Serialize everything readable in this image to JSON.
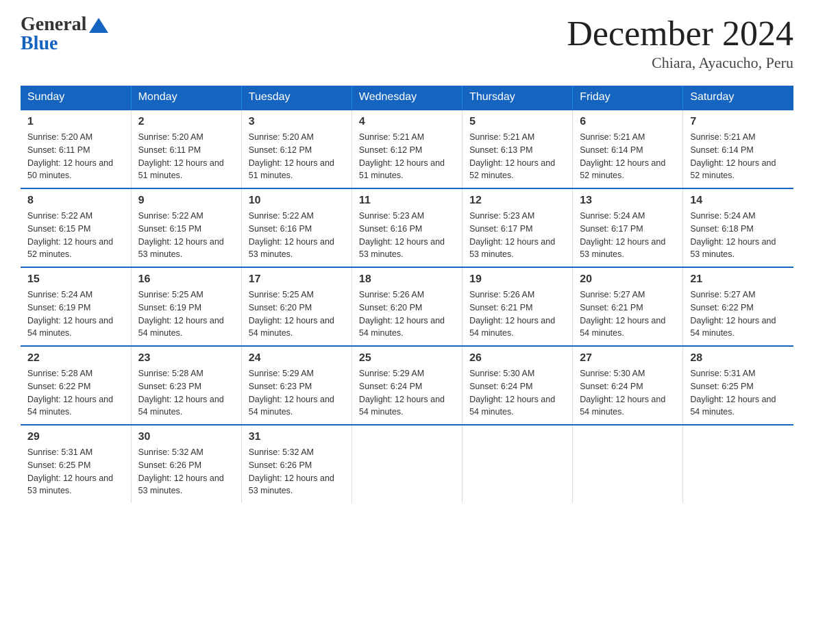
{
  "logo": {
    "general": "General",
    "triangle_color": "#1565c0",
    "blue": "Blue"
  },
  "title": {
    "month_year": "December 2024",
    "location": "Chiara, Ayacucho, Peru"
  },
  "header_days": [
    "Sunday",
    "Monday",
    "Tuesday",
    "Wednesday",
    "Thursday",
    "Friday",
    "Saturday"
  ],
  "weeks": [
    [
      {
        "day": "1",
        "sunrise": "5:20 AM",
        "sunset": "6:11 PM",
        "daylight": "12 hours and 50 minutes."
      },
      {
        "day": "2",
        "sunrise": "5:20 AM",
        "sunset": "6:11 PM",
        "daylight": "12 hours and 51 minutes."
      },
      {
        "day": "3",
        "sunrise": "5:20 AM",
        "sunset": "6:12 PM",
        "daylight": "12 hours and 51 minutes."
      },
      {
        "day": "4",
        "sunrise": "5:21 AM",
        "sunset": "6:12 PM",
        "daylight": "12 hours and 51 minutes."
      },
      {
        "day": "5",
        "sunrise": "5:21 AM",
        "sunset": "6:13 PM",
        "daylight": "12 hours and 52 minutes."
      },
      {
        "day": "6",
        "sunrise": "5:21 AM",
        "sunset": "6:14 PM",
        "daylight": "12 hours and 52 minutes."
      },
      {
        "day": "7",
        "sunrise": "5:21 AM",
        "sunset": "6:14 PM",
        "daylight": "12 hours and 52 minutes."
      }
    ],
    [
      {
        "day": "8",
        "sunrise": "5:22 AM",
        "sunset": "6:15 PM",
        "daylight": "12 hours and 52 minutes."
      },
      {
        "day": "9",
        "sunrise": "5:22 AM",
        "sunset": "6:15 PM",
        "daylight": "12 hours and 53 minutes."
      },
      {
        "day": "10",
        "sunrise": "5:22 AM",
        "sunset": "6:16 PM",
        "daylight": "12 hours and 53 minutes."
      },
      {
        "day": "11",
        "sunrise": "5:23 AM",
        "sunset": "6:16 PM",
        "daylight": "12 hours and 53 minutes."
      },
      {
        "day": "12",
        "sunrise": "5:23 AM",
        "sunset": "6:17 PM",
        "daylight": "12 hours and 53 minutes."
      },
      {
        "day": "13",
        "sunrise": "5:24 AM",
        "sunset": "6:17 PM",
        "daylight": "12 hours and 53 minutes."
      },
      {
        "day": "14",
        "sunrise": "5:24 AM",
        "sunset": "6:18 PM",
        "daylight": "12 hours and 53 minutes."
      }
    ],
    [
      {
        "day": "15",
        "sunrise": "5:24 AM",
        "sunset": "6:19 PM",
        "daylight": "12 hours and 54 minutes."
      },
      {
        "day": "16",
        "sunrise": "5:25 AM",
        "sunset": "6:19 PM",
        "daylight": "12 hours and 54 minutes."
      },
      {
        "day": "17",
        "sunrise": "5:25 AM",
        "sunset": "6:20 PM",
        "daylight": "12 hours and 54 minutes."
      },
      {
        "day": "18",
        "sunrise": "5:26 AM",
        "sunset": "6:20 PM",
        "daylight": "12 hours and 54 minutes."
      },
      {
        "day": "19",
        "sunrise": "5:26 AM",
        "sunset": "6:21 PM",
        "daylight": "12 hours and 54 minutes."
      },
      {
        "day": "20",
        "sunrise": "5:27 AM",
        "sunset": "6:21 PM",
        "daylight": "12 hours and 54 minutes."
      },
      {
        "day": "21",
        "sunrise": "5:27 AM",
        "sunset": "6:22 PM",
        "daylight": "12 hours and 54 minutes."
      }
    ],
    [
      {
        "day": "22",
        "sunrise": "5:28 AM",
        "sunset": "6:22 PM",
        "daylight": "12 hours and 54 minutes."
      },
      {
        "day": "23",
        "sunrise": "5:28 AM",
        "sunset": "6:23 PM",
        "daylight": "12 hours and 54 minutes."
      },
      {
        "day": "24",
        "sunrise": "5:29 AM",
        "sunset": "6:23 PM",
        "daylight": "12 hours and 54 minutes."
      },
      {
        "day": "25",
        "sunrise": "5:29 AM",
        "sunset": "6:24 PM",
        "daylight": "12 hours and 54 minutes."
      },
      {
        "day": "26",
        "sunrise": "5:30 AM",
        "sunset": "6:24 PM",
        "daylight": "12 hours and 54 minutes."
      },
      {
        "day": "27",
        "sunrise": "5:30 AM",
        "sunset": "6:24 PM",
        "daylight": "12 hours and 54 minutes."
      },
      {
        "day": "28",
        "sunrise": "5:31 AM",
        "sunset": "6:25 PM",
        "daylight": "12 hours and 54 minutes."
      }
    ],
    [
      {
        "day": "29",
        "sunrise": "5:31 AM",
        "sunset": "6:25 PM",
        "daylight": "12 hours and 53 minutes."
      },
      {
        "day": "30",
        "sunrise": "5:32 AM",
        "sunset": "6:26 PM",
        "daylight": "12 hours and 53 minutes."
      },
      {
        "day": "31",
        "sunrise": "5:32 AM",
        "sunset": "6:26 PM",
        "daylight": "12 hours and 53 minutes."
      },
      null,
      null,
      null,
      null
    ]
  ]
}
